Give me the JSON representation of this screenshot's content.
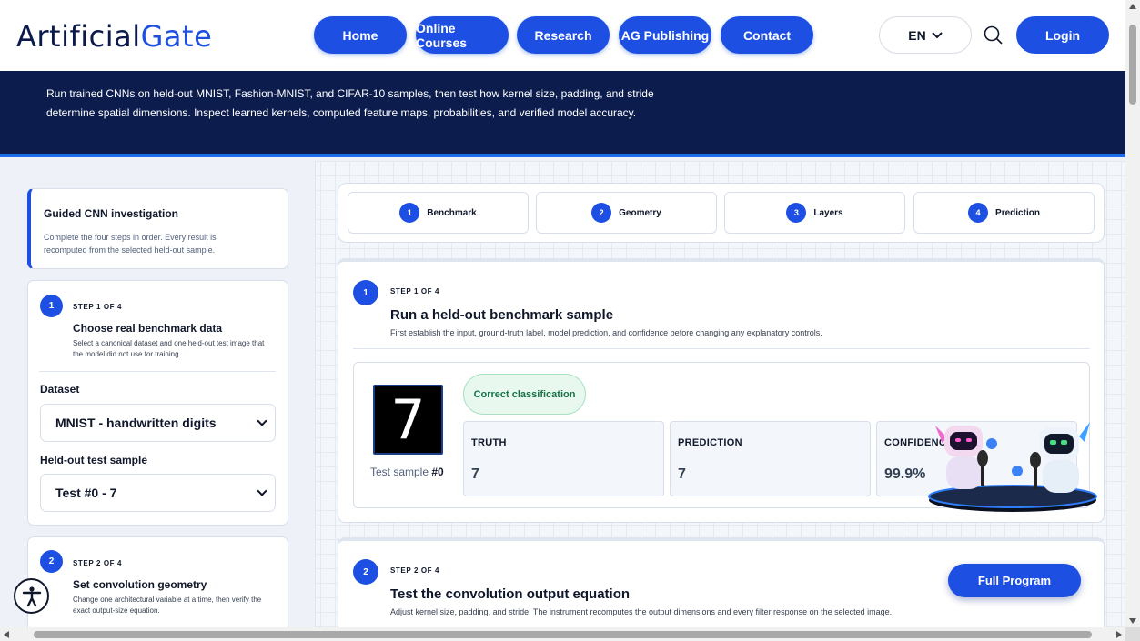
{
  "header": {
    "logo_part1": "Artificial",
    "logo_part2": "Gate",
    "nav": [
      {
        "label": "Home"
      },
      {
        "label": "Online Courses"
      },
      {
        "label": "Research"
      },
      {
        "label": "AG Publishing"
      },
      {
        "label": "Contact"
      }
    ],
    "language": "EN",
    "login_label": "Login"
  },
  "banner": {
    "text": "Run trained CNNs on held-out MNIST, Fashion-MNIST, and CIFAR-10 samples, then test how kernel size, padding, and stride determine spatial dimensions. Inspect learned kernels, computed feature maps, probabilities, and verified model accuracy."
  },
  "sidebar": {
    "guided_title": "Guided CNN investigation",
    "guided_desc": "Complete the four steps in order. Every result is recomputed from the selected held-out sample.",
    "step1": {
      "num": "1",
      "kicker": "STEP 1 OF 4",
      "title": "Choose real benchmark data",
      "desc": "Select a canonical dataset and one held-out test image that the model did not use for training.",
      "dataset_label": "Dataset",
      "dataset_value": "MNIST - handwritten digits",
      "sample_label": "Held-out test sample",
      "sample_value": "Test #0 - 7"
    },
    "step2": {
      "num": "2",
      "kicker": "STEP 2 OF 4",
      "title": "Set convolution geometry",
      "desc": "Change one architectural variable at a time, then verify the exact output-size equation."
    }
  },
  "tabs": [
    {
      "num": "1",
      "label": "Benchmark"
    },
    {
      "num": "2",
      "label": "Geometry"
    },
    {
      "num": "3",
      "label": "Layers"
    },
    {
      "num": "4",
      "label": "Prediction"
    }
  ],
  "step1_panel": {
    "num": "1",
    "kicker": "STEP 1 OF 4",
    "title": "Run a held-out benchmark sample",
    "desc": "First establish the input, ground-truth label, model prediction, and confidence before changing any explanatory controls.",
    "digit": "7",
    "sample_caption": "Test sample ",
    "sample_id": "#0",
    "badge": "Correct classification",
    "metrics": [
      {
        "key": "TRUTH",
        "value": "7"
      },
      {
        "key": "PREDICTION",
        "value": "7"
      },
      {
        "key": "CONFIDENCE",
        "value": "99.9%"
      }
    ]
  },
  "step2_panel": {
    "num": "2",
    "kicker": "STEP 2 OF 4",
    "title": "Test the convolution output equation",
    "desc": "Adjust kernel size, padding, and stride. The instrument recomputes the output dimensions and every filter response on the selected image."
  },
  "full_program_label": "Full Program",
  "colors": {
    "accent": "#1d4fe3",
    "banner": "#0c1d4d",
    "success": "#157347"
  }
}
